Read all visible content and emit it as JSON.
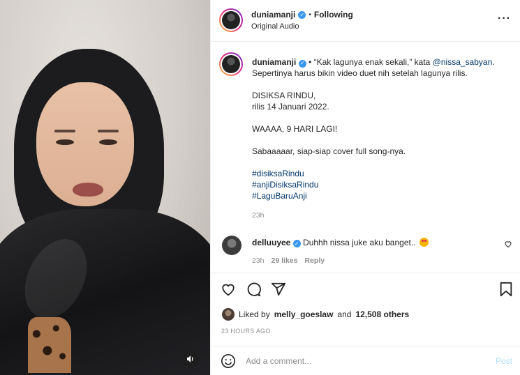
{
  "header": {
    "username": "duniamanji",
    "separator": "•",
    "follow_status": "Following",
    "audio": "Original Audio",
    "more_icon": "more-horizontal-icon"
  },
  "caption": {
    "username": "duniamanji",
    "line1_prefix": "• “Kak lagunya enak sekali,” kata",
    "mention": "@nissa_sabyan",
    "line1_suffix": ". Sepertinya harus bikin video duet nih setelah lagunya rilis.",
    "title_line": "DISIKSA RINDU,",
    "release_line": "rilis 14 Januari 2022.",
    "countdown": "WAAAA, 9 HARI LAGI!",
    "cover_note": "Sabaaaaar, siap-siap cover full song-nya.",
    "hashtags": [
      "#disiksaRindu",
      "#anjiDisiksaRindu",
      "#LaguBaruAnji"
    ],
    "time": "23h"
  },
  "comment": {
    "username": "delluuyee",
    "text": "Duhhh nissa juke aku banget..",
    "time": "23h",
    "likes": "29 likes",
    "reply": "Reply"
  },
  "likes": {
    "prefix": "Liked by",
    "user": "melly_goeslaw",
    "middle": "and",
    "count": "12,508 others"
  },
  "post_date": "23 HOURS AGO",
  "add_comment": {
    "placeholder": "Add a comment...",
    "post_label": "Post"
  },
  "colors": {
    "verified": "#3897f0",
    "link": "#00376b",
    "post_button": "#b2dffc"
  }
}
